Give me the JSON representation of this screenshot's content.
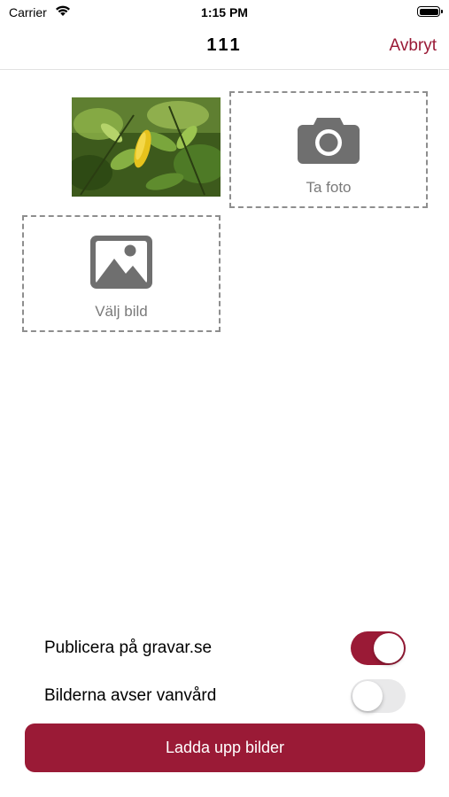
{
  "status_bar": {
    "carrier": "Carrier",
    "time": "1:15 PM",
    "icons": [
      "wifi-icon",
      "battery-icon"
    ]
  },
  "nav": {
    "title": "111",
    "cancel_label": "Avbryt"
  },
  "media": {
    "photo_icon": "leaf-photo-thumbnail",
    "take_photo": {
      "label": "Ta foto",
      "icon": "camera-icon"
    },
    "choose_image": {
      "label": "Välj bild",
      "icon": "image-icon"
    }
  },
  "options": [
    {
      "label": "Publicera på gravar.se",
      "enabled": true
    },
    {
      "label": "Bilderna avser vanvård",
      "enabled": false
    }
  ],
  "upload_button": {
    "label": "Ladda upp bilder"
  },
  "colors": {
    "accent": "#9a1a36",
    "dashed_border": "#8e8e8e",
    "icon_gray": "#6f6f6f",
    "switch_off": "#e9e9ea"
  }
}
